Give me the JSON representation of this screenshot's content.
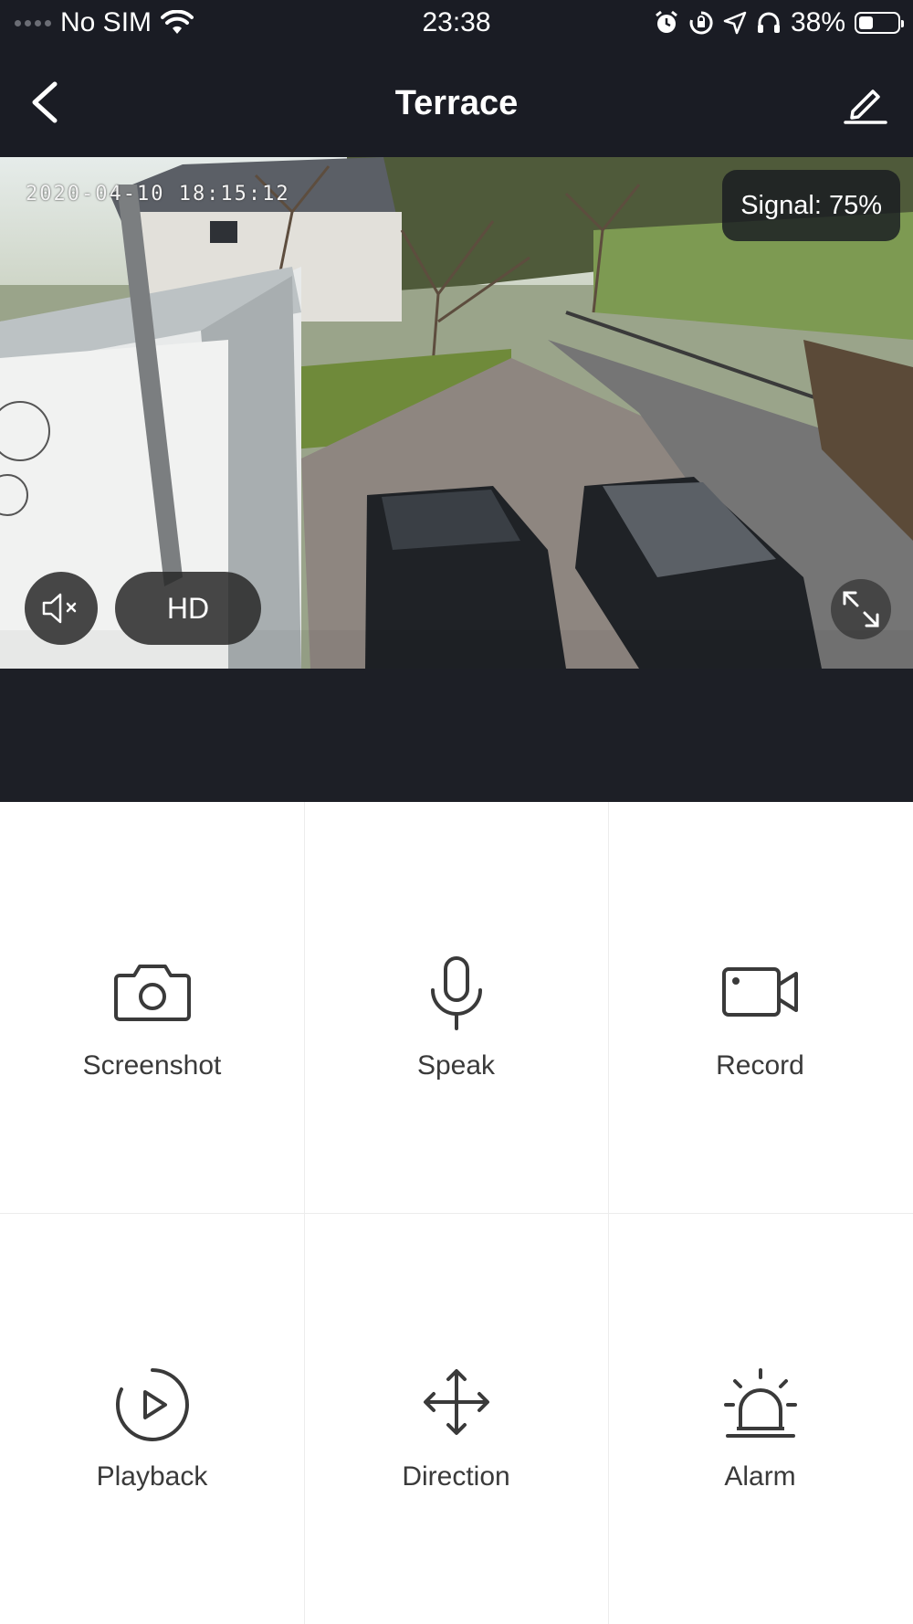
{
  "status_bar": {
    "carrier": "No SIM",
    "time": "23:38",
    "battery_percent_label": "38%",
    "battery_level": 0.38
  },
  "nav": {
    "title": "Terrace",
    "back_icon": "chevron-left-icon",
    "edit_icon": "pencil-icon"
  },
  "video": {
    "timestamp": "2020-04-10 18:15:12",
    "signal_label": "Signal: 75%",
    "quality_label": "HD",
    "mute_icon": "speaker-muted-icon",
    "fullscreen_icon": "expand-icon"
  },
  "controls": [
    {
      "label": "Screenshot",
      "icon": "camera-icon"
    },
    {
      "label": "Speak",
      "icon": "microphone-icon"
    },
    {
      "label": "Record",
      "icon": "video-camera-icon"
    },
    {
      "label": "Playback",
      "icon": "playback-icon"
    },
    {
      "label": "Direction",
      "icon": "move-arrows-icon"
    },
    {
      "label": "Alarm",
      "icon": "siren-icon"
    }
  ],
  "colors": {
    "header_bg": "#1a1c24",
    "icon_color": "#3a3a3a"
  }
}
